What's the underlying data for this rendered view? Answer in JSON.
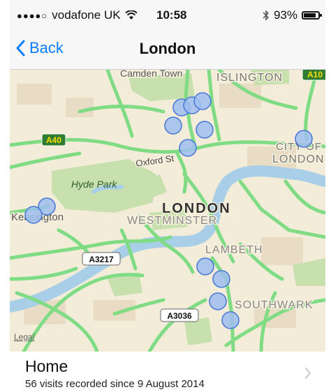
{
  "status_bar": {
    "carrier": "vodafone UK",
    "time": "10:58",
    "battery_percent": "93%",
    "battery_level": 0.93
  },
  "nav": {
    "back_label": "Back",
    "title": "London"
  },
  "map": {
    "labels": {
      "camden_town": "Camden Town",
      "islington": "ISLINGTON",
      "a10": "A10",
      "a40": "A40",
      "city_of": "CITY OF",
      "london_city": "LONDON",
      "oxford_st": "Oxford St",
      "hyde_park": "Hyde Park",
      "kensington": "Kensington",
      "london": "LONDON",
      "westminster": "WESTMINSTER",
      "lambeth": "LAMBETH",
      "a3217": "A3217",
      "southwark": "SOUTHWARK",
      "a3036": "A3036",
      "legal": "Legal"
    },
    "colors": {
      "land": "#f2ecd9",
      "park": "#c8dfae",
      "water": "#a9cfe8",
      "road": "#7fdc84",
      "marker_fill": "#9fbef0",
      "marker_stroke": "#4d79d9"
    }
  },
  "place": {
    "name": "Home",
    "visits_text": "56 visits recorded since 9 August 2014"
  }
}
